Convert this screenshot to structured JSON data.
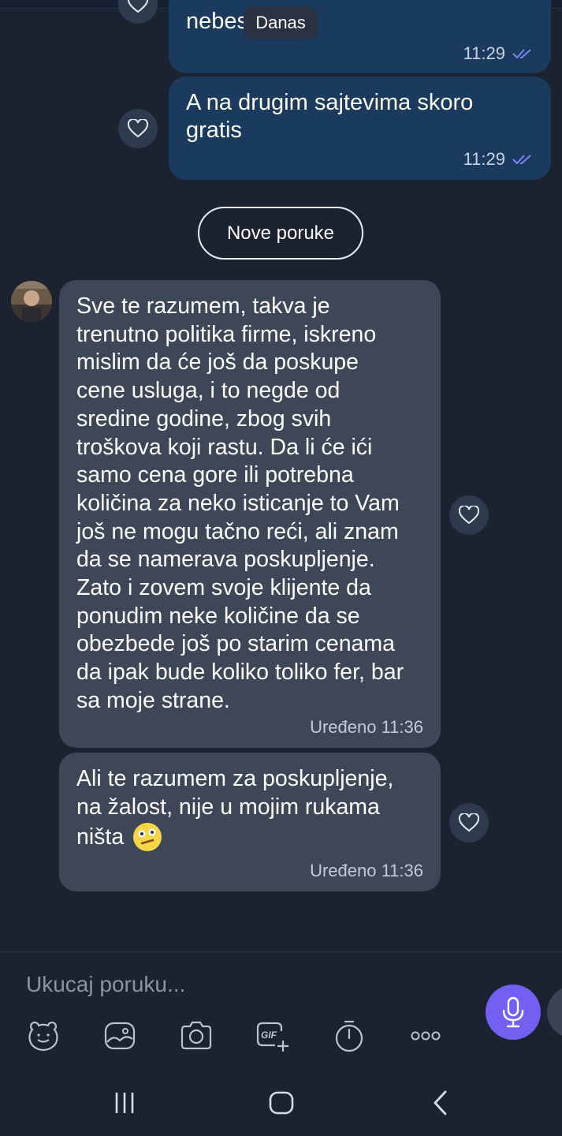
{
  "chat": {
    "date_chip": "Danas",
    "messages_out": [
      {
        "text": "nebesa",
        "time": "11:29"
      },
      {
        "text": "A na drugim sajtevima skoro gratis",
        "time": "11:29"
      }
    ],
    "new_messages_label": "Nove poruke",
    "messages_in": [
      {
        "lines": [
          "Sve te razumem, takva je",
          "trenutno politika firme, iskreno",
          "mislim da će još da poskupe",
          "cene usluga, i to negde od",
          "sredine godine, zbog svih",
          "troškova koji rastu. Da li će ići",
          "samo cena gore ili potrebna",
          "količina za neko isticanje to Vam",
          "još ne mogu tačno reći, ali znam",
          "da se namerava poskupljenje.",
          "Zato i zovem svoje klijente da",
          "ponudim neke količine da se",
          "obezbede još po starim cenama",
          "da ipak bude koliko toliko fer, bar",
          "sa moje strane."
        ],
        "meta": "Uređeno 11:36"
      },
      {
        "lines": [
          "Ali te razumem za poskupljenje,",
          "na žalost, nije u mojim rukama",
          "ništa"
        ],
        "emoji": "confused-face",
        "meta": "Uređeno 11:36"
      }
    ]
  },
  "composer": {
    "placeholder": "Ukucaj poruku...",
    "tools": [
      "sticker-icon",
      "gallery-icon",
      "camera-icon",
      "gif-icon",
      "timer-icon",
      "more-icon"
    ],
    "mic": "microphone-icon"
  },
  "colors": {
    "background": "#1c2330",
    "outgoing_bubble": "#1a3a5e",
    "incoming_bubble": "#3d4758",
    "accent": "#7360f2",
    "read_ticks": "#7b86f0"
  },
  "system_nav": [
    "recents-icon",
    "home-icon",
    "back-icon"
  ]
}
